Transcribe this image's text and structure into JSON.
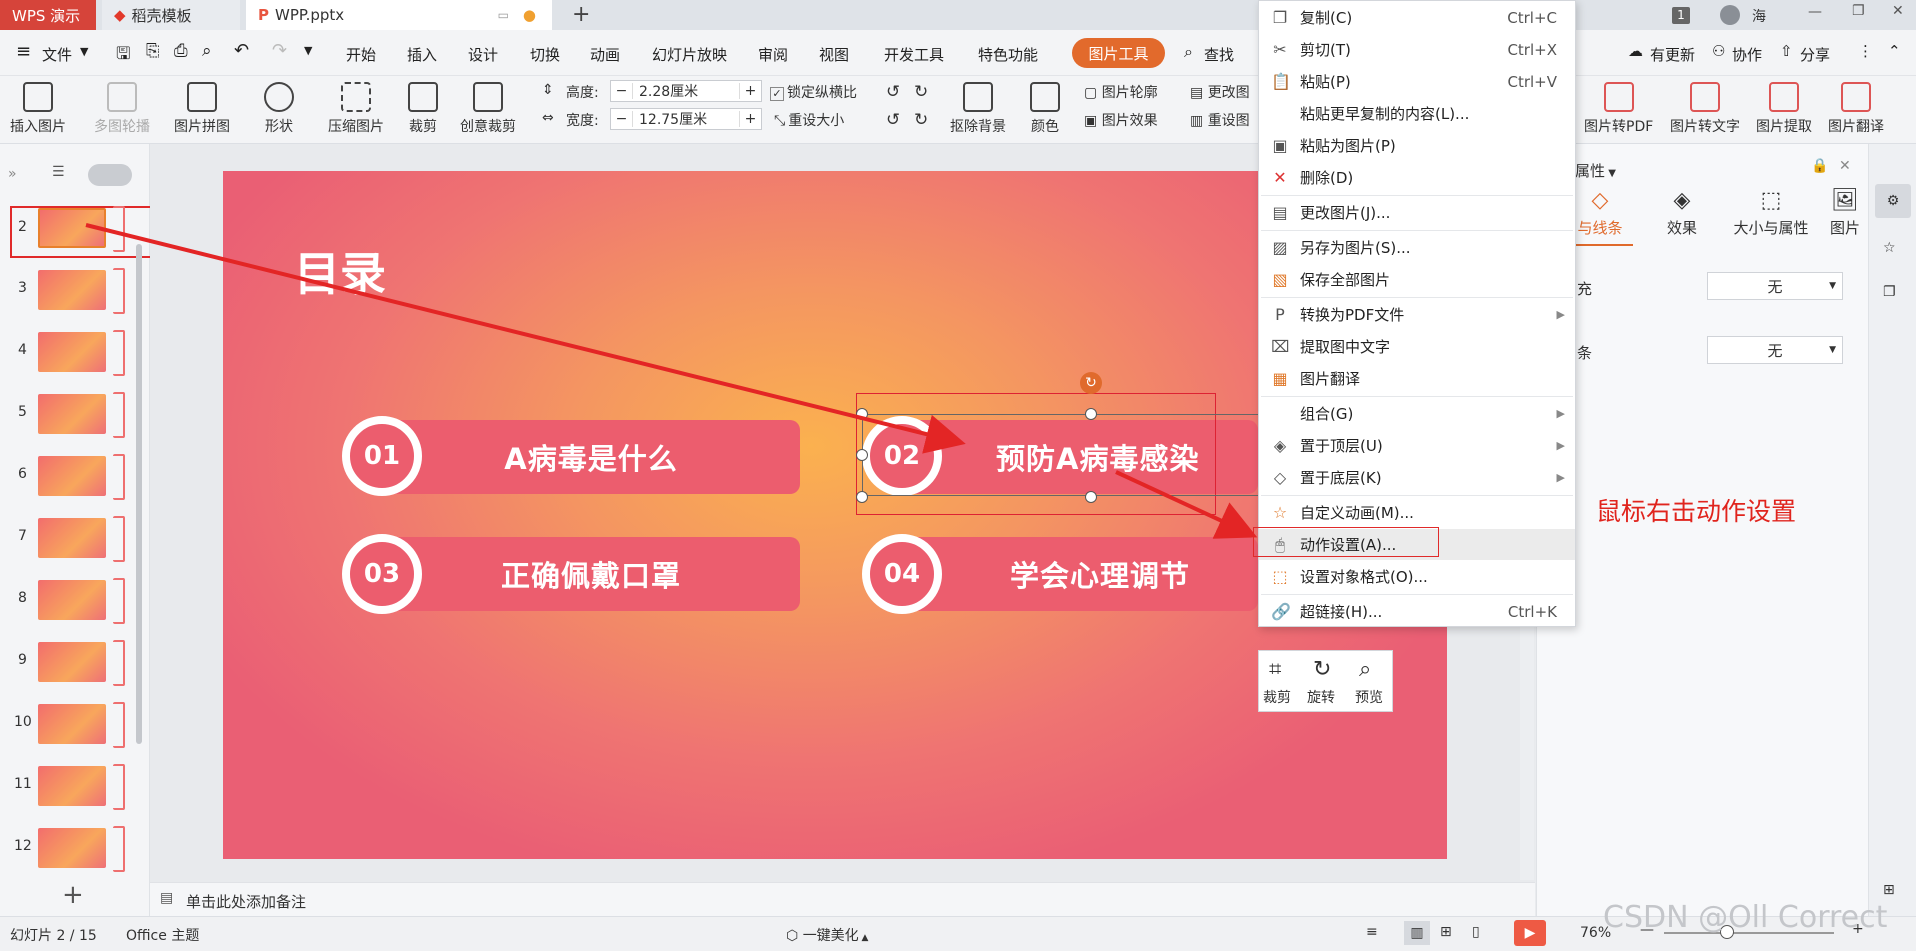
{
  "titlebar": {
    "app_tab": "WPS 演示",
    "template_tab": "稻壳模板",
    "file_tab": "WPP.pptx",
    "page_badge": "1",
    "user_name": "海"
  },
  "menubar": {
    "file": "文件",
    "items": [
      "开始",
      "插入",
      "设计",
      "切换",
      "动画",
      "幻灯片放映",
      "审阅",
      "视图",
      "开发工具",
      "特色功能"
    ],
    "picture_tools": "图片工具",
    "search": "查找",
    "update": "有更新",
    "collab": "协作",
    "share": "分享"
  },
  "ribbon": {
    "insert_picture": "插入图片",
    "multi_outline": "多图轮播",
    "picture_collage": "图片拼图",
    "shape": "形状",
    "compress": "压缩图片",
    "crop": "裁剪",
    "creative_crop": "创意裁剪",
    "height_label": "高度:",
    "height_value": "2.28厘米",
    "width_label": "宽度:",
    "width_value": "12.75厘米",
    "lock_ratio": "锁定纵横比",
    "reset_size": "重设大小",
    "remove_bg": "抠除背景",
    "color": "颜色",
    "outline": "图片轮廓",
    "effects": "图片效果",
    "change_pic": "更改图",
    "reset_pic": "重设图",
    "to_pdf": "图片转PDF",
    "to_text": "图片转文字",
    "extract": "图片提取",
    "translate": "图片翻译"
  },
  "thumbs": {
    "numbers": [
      "2",
      "3",
      "4",
      "5",
      "6",
      "7",
      "8",
      "9",
      "10",
      "11",
      "12"
    ],
    "add": "+"
  },
  "slide": {
    "title": "目录",
    "items": [
      {
        "num": "01",
        "text": "A病毒是什么"
      },
      {
        "num": "02",
        "text": "预防A病毒感染"
      },
      {
        "num": "03",
        "text": "正确佩戴口罩"
      },
      {
        "num": "04",
        "text": "学会心理调节"
      }
    ]
  },
  "context_menu": [
    {
      "label": "复制(C)",
      "shortcut": "Ctrl+C",
      "icon": "copy-icon"
    },
    {
      "label": "剪切(T)",
      "shortcut": "Ctrl+X",
      "icon": "cut-icon"
    },
    {
      "label": "粘贴(P)",
      "shortcut": "Ctrl+V",
      "icon": "paste-icon"
    },
    {
      "label": "粘贴更早复制的内容(L)...",
      "shortcut": "",
      "icon": ""
    },
    {
      "label": "粘贴为图片(P)",
      "shortcut": "",
      "icon": "paste-as-picture-icon"
    },
    {
      "label": "删除(D)",
      "shortcut": "",
      "icon": "delete-icon"
    },
    {
      "label": "更改图片(J)...",
      "shortcut": "",
      "icon": "change-picture-icon"
    },
    {
      "label": "另存为图片(S)...",
      "shortcut": "",
      "icon": "save-as-picture-icon"
    },
    {
      "label": "保存全部图片",
      "shortcut": "",
      "icon": "save-all-pictures-icon"
    },
    {
      "label": "转换为PDF文件",
      "shortcut": "",
      "icon": "pdf-icon"
    },
    {
      "label": "提取图中文字",
      "shortcut": "",
      "icon": "extract-text-icon"
    },
    {
      "label": "图片翻译",
      "shortcut": "",
      "icon": "translate-icon"
    },
    {
      "label": "组合(G)",
      "shortcut": "",
      "icon": ""
    },
    {
      "label": "置于顶层(U)",
      "shortcut": "",
      "icon": "bring-to-front-icon"
    },
    {
      "label": "置于底层(K)",
      "shortcut": "",
      "icon": "send-to-back-icon"
    },
    {
      "label": "自定义动画(M)...",
      "shortcut": "",
      "icon": "custom-animation-icon"
    },
    {
      "label": "动作设置(A)...",
      "shortcut": "",
      "icon": "action-settings-icon"
    },
    {
      "label": "设置对象格式(O)...",
      "shortcut": "",
      "icon": "format-object-icon"
    },
    {
      "label": "超链接(H)...",
      "shortcut": "Ctrl+K",
      "icon": "hyperlink-icon"
    }
  ],
  "mini_toolbar": {
    "crop": "裁剪",
    "rotate": "旋转",
    "preview": "预览"
  },
  "right_panel": {
    "title": "属性",
    "tabs": [
      "与线条",
      "效果",
      "大小与属性",
      "图片"
    ],
    "fill_label": "充",
    "fill_value": "无",
    "line_label": "条",
    "line_value": "无"
  },
  "annotation": "鼠标右击动作设置",
  "notes_placeholder": "单击此处添加备注",
  "statusbar": {
    "slide_info": "幻灯片 2 / 15",
    "theme": "Office 主题",
    "beautify": "一键美化",
    "zoom": "76%"
  },
  "watermark": "CSDN @Oll Correct",
  "colors": {
    "accent": "#e26a2c",
    "wps_red": "#d6443a",
    "annotation_red": "#e0241d",
    "pill": "#ec5d6e"
  }
}
